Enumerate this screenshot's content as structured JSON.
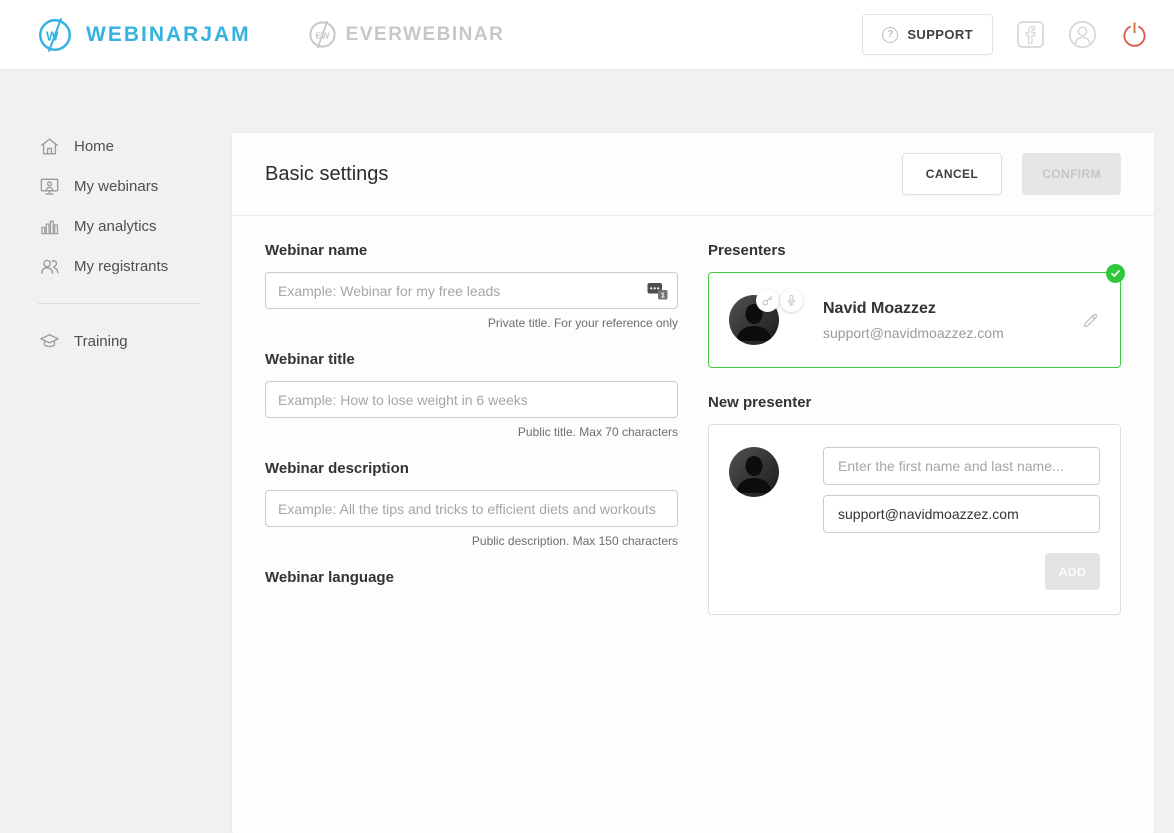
{
  "header": {
    "brand": {
      "name": "WEBINARJAM",
      "monogram": "W"
    },
    "secondary_brand": {
      "name": "EVERWEBINAR",
      "monogram": "EW"
    },
    "support": {
      "label": "SUPPORT",
      "icon_glyph": "?"
    }
  },
  "sidebar": {
    "items": [
      {
        "label": "Home"
      },
      {
        "label": "My webinars"
      },
      {
        "label": "My analytics"
      },
      {
        "label": "My registrants"
      },
      {
        "label": "Training"
      }
    ]
  },
  "main": {
    "title": "Basic settings",
    "actions": {
      "cancel": "CANCEL",
      "confirm": "CONFIRM"
    },
    "fields": {
      "name": {
        "label": "Webinar name",
        "placeholder": "Example: Webinar for my free leads",
        "helper": "Private title. For your reference only",
        "lang_badge": "1"
      },
      "title": {
        "label": "Webinar title",
        "placeholder": "Example: How to lose weight in 6 weeks",
        "helper": "Public title. Max 70 characters"
      },
      "description": {
        "label": "Webinar description",
        "placeholder": "Example: All the tips and tricks to efficient diets and workouts",
        "helper": "Public description. Max 150 characters"
      },
      "language": {
        "label": "Webinar language"
      }
    },
    "presenters": {
      "label": "Presenters",
      "presenter": {
        "name": "Navid Moazzez",
        "email": "support@navidmoazzez.com"
      }
    },
    "new_presenter": {
      "label": "New presenter",
      "name_placeholder": "Enter the first name and last name...",
      "email_value": "support@navidmoazzez.com",
      "add_label": "ADD"
    }
  },
  "colors": {
    "brand_blue": "#35b2e0",
    "accent_green": "#3ecb3e",
    "power_red": "#dd5a4f"
  }
}
